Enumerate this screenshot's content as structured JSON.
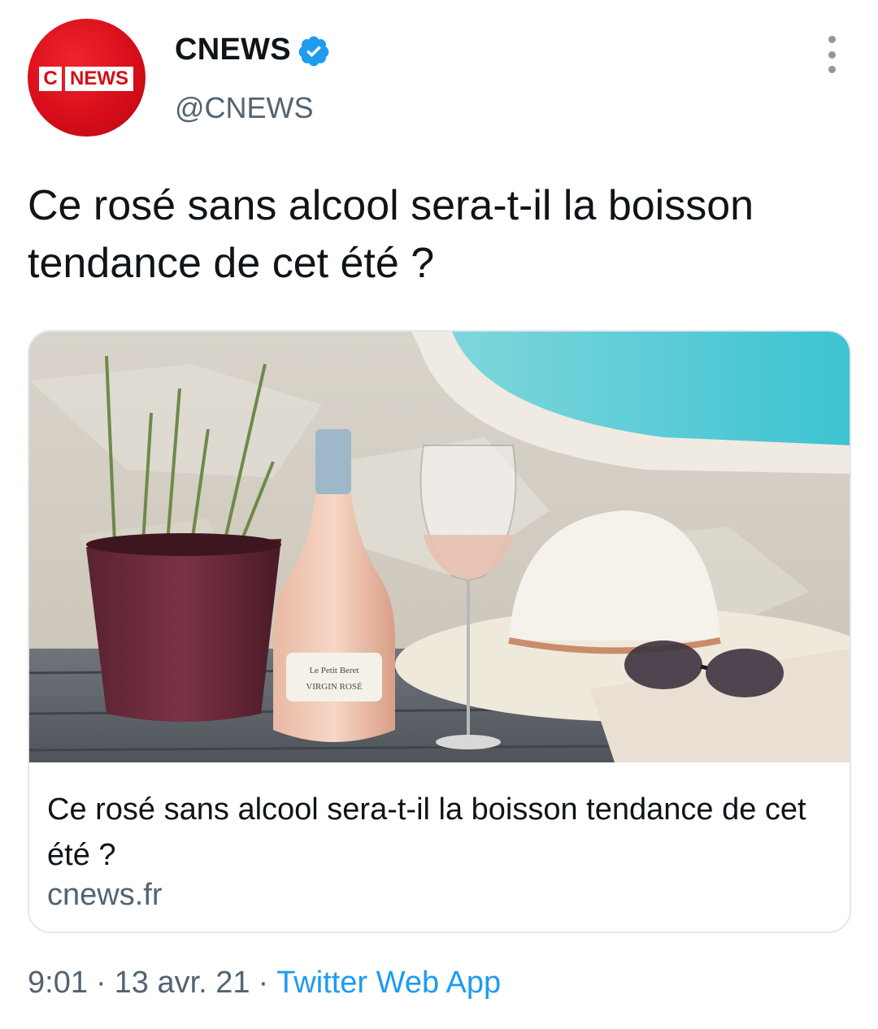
{
  "author": {
    "display_name": "CNEWS",
    "handle": "@CNEWS",
    "avatar_text_c": "C",
    "avatar_text_news": "NEWS",
    "verified": true
  },
  "tweet": {
    "text": "Ce rosé sans alcool sera-t-il la boisson tendance de cet été ?"
  },
  "card": {
    "title": "Ce rosé sans alcool sera-t-il la boisson tendance de cet été ?",
    "domain": "cnews.fr",
    "image_label_line1": "Le Petit Beret",
    "image_label_line2": "VIRGIN ROSÉ"
  },
  "meta": {
    "time": "9:01",
    "date": "13 avr. 21",
    "separator": "·",
    "source": "Twitter Web App"
  },
  "colors": {
    "brand_red": "#d50d18",
    "verified_blue": "#1d9bf0",
    "link_blue": "#1d9bf0",
    "secondary_text": "#536471"
  }
}
